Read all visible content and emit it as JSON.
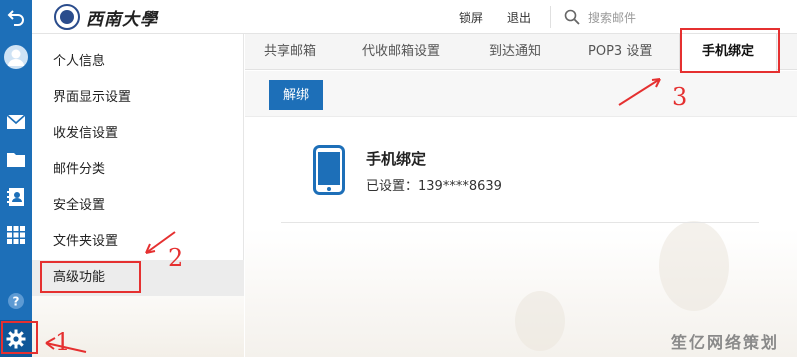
{
  "header": {
    "logo_text": "西南大學",
    "lock_label": "锁屏",
    "logout_label": "退出",
    "search_placeholder": "搜索邮件"
  },
  "rail": {
    "icons": [
      "back-icon",
      "avatar-icon",
      "mail-icon",
      "folder-icon",
      "contacts-icon",
      "apps-icon",
      "help-icon",
      "settings-icon"
    ]
  },
  "menu": {
    "items": [
      {
        "label": "个人信息"
      },
      {
        "label": "界面显示设置"
      },
      {
        "label": "收发信设置"
      },
      {
        "label": "邮件分类"
      },
      {
        "label": "安全设置"
      },
      {
        "label": "文件夹设置"
      },
      {
        "label": "高级功能"
      }
    ],
    "active_index": 6
  },
  "tabs": [
    {
      "label": "共享邮箱"
    },
    {
      "label": "代收邮箱设置"
    },
    {
      "label": "到达通知"
    },
    {
      "label": "POP3 设置"
    },
    {
      "label": "手机绑定"
    }
  ],
  "active_tab": 4,
  "content": {
    "unbind_label": "解绑",
    "bind_title": "手机绑定",
    "bind_status": "已设置：139****8639"
  },
  "annotations": {
    "one": "1",
    "two": "2",
    "three": "3",
    "color": "#e53030"
  },
  "watermark": "笙亿网络策划",
  "colors": {
    "accent": "#1d6fb8"
  }
}
